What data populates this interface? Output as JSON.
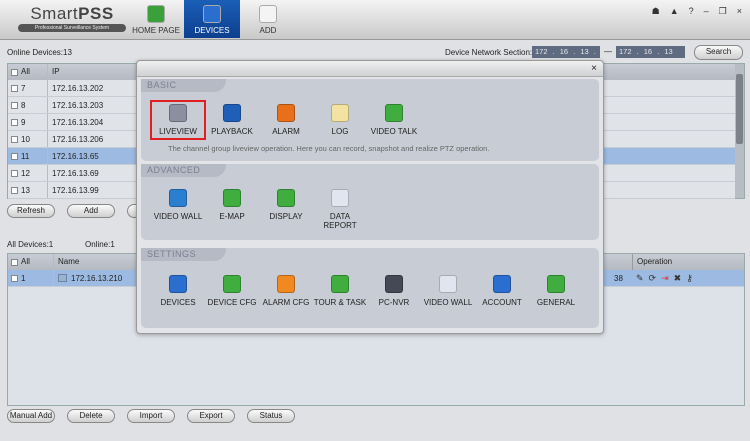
{
  "app": {
    "logo_title_light": "Smart",
    "logo_title_bold": "PSS",
    "logo_subtitle": "Professional Surveillance System"
  },
  "nav": [
    {
      "label": "HOME PAGE",
      "icon": "home-icon",
      "color": "#3aa13a"
    },
    {
      "label": "DEVICES",
      "icon": "camera-dome-icon",
      "color": "#2a6fd0",
      "active": true
    },
    {
      "label": "ADD",
      "icon": "plus-icon",
      "color": "#f4f4f4"
    }
  ],
  "window_controls": [
    "user-icon",
    "lock-icon",
    "help-icon",
    "minimize-icon",
    "restore-icon",
    "close-icon"
  ],
  "window_control_glyphs": [
    "☗",
    "▲",
    "?",
    "–",
    "❐",
    "×"
  ],
  "search": {
    "online_label": "Online Devices:13",
    "section_label": "Device Network Section:",
    "start_ip": "172 . 16 . 13 . 0",
    "end_ip": "172 . 16 . 13 .255",
    "dash": "—",
    "button": "Search"
  },
  "online_table": {
    "headers": [
      "All",
      "IP"
    ],
    "rows": [
      {
        "no": "7",
        "ip": "172.16.13.202"
      },
      {
        "no": "8",
        "ip": "172.16.13.203"
      },
      {
        "no": "9",
        "ip": "172.16.13.204"
      },
      {
        "no": "10",
        "ip": "172.16.13.206"
      },
      {
        "no": "11",
        "ip": "172.16.13.65",
        "selected": true
      },
      {
        "no": "12",
        "ip": "172.16.13.69"
      },
      {
        "no": "13",
        "ip": "172.16.13.99"
      }
    ]
  },
  "online_buttons": [
    "Refresh",
    "Add",
    ""
  ],
  "all_devices": {
    "count_label": "All Devices:1",
    "online_label": "Online:1",
    "headers": [
      "All",
      "Name",
      "Operation"
    ],
    "rows": [
      {
        "no": "1",
        "name": "172.16.13.210",
        "partial": "38"
      }
    ]
  },
  "operations": [
    {
      "icon": "edit-icon",
      "glyph": "✎"
    },
    {
      "icon": "refresh-icon",
      "glyph": "⟳"
    },
    {
      "icon": "logout-icon",
      "glyph": "⇥"
    },
    {
      "icon": "delete-icon",
      "glyph": "✖"
    },
    {
      "icon": "key-icon",
      "glyph": "⚷"
    }
  ],
  "bottom_buttons": [
    "Manual Add",
    "Delete",
    "Import",
    "Export",
    "Status"
  ],
  "modal": {
    "close": "×",
    "basic": {
      "title": "BASIC",
      "items": [
        {
          "label": "LIVEVIEW",
          "color": "#8a90a0",
          "selected": true
        },
        {
          "label": "PLAYBACK",
          "color": "#1f5fb8"
        },
        {
          "label": "ALARM",
          "color": "#e8701a"
        },
        {
          "label": "LOG",
          "color": "#f2e3a0"
        },
        {
          "label": "VIDEO TALK",
          "color": "#3fae3f"
        }
      ],
      "description": "The channel group liveview operation. Here you can record, snapshot and realize PTZ operation."
    },
    "advanced": {
      "title": "ADVANCED",
      "items": [
        {
          "label": "VIDEO WALL",
          "color": "#2a7fd0"
        },
        {
          "label": "E-MAP",
          "color": "#3fae3f"
        },
        {
          "label": "DISPLAY",
          "color": "#3fae3f"
        },
        {
          "label": "DATA REPORT",
          "color": "#e0e6f0"
        }
      ]
    },
    "settings": {
      "title": "SETTINGS",
      "items": [
        {
          "label": "DEVICES",
          "color": "#2a6fd0"
        },
        {
          "label": "DEVICE CFG",
          "color": "#3fae3f"
        },
        {
          "label": "ALARM CFG",
          "color": "#f08a20"
        },
        {
          "label": "TOUR & TASK",
          "color": "#3fae3f"
        },
        {
          "label": "PC-NVR",
          "color": "#444a55"
        },
        {
          "label": "VIDEO WALL",
          "color": "#dfe6ef"
        },
        {
          "label": "ACCOUNT",
          "color": "#2a6fd0"
        },
        {
          "label": "GENERAL",
          "color": "#3fae3f"
        }
      ]
    }
  }
}
